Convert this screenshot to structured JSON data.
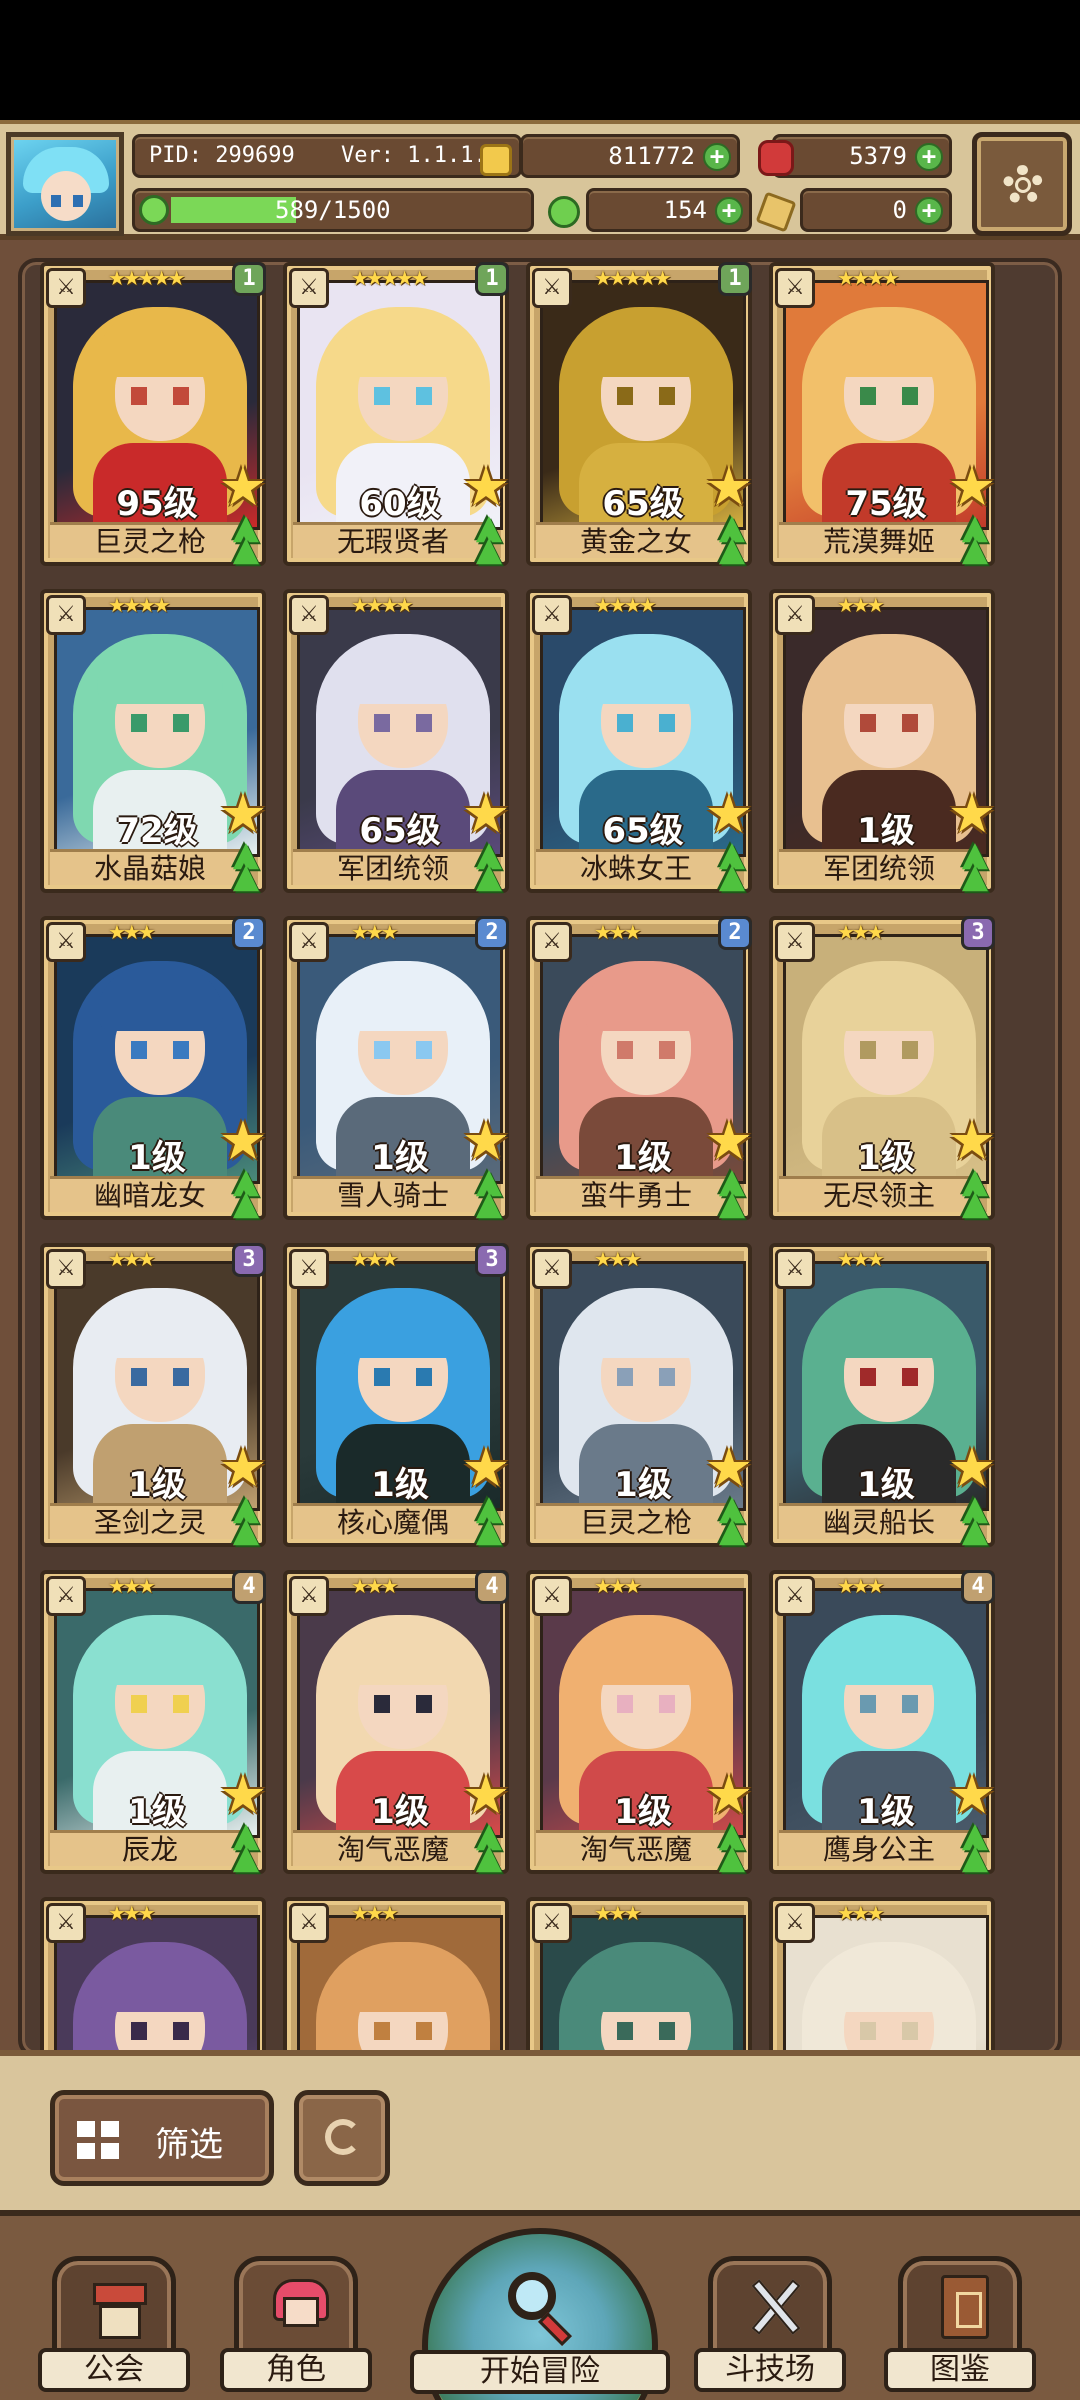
{
  "header": {
    "pid": "PID: 299699",
    "version": "Ver: 1.1.1.0",
    "gold": "811772",
    "gems": "5379",
    "exp": "589/1500",
    "exp_fraction": 0.39,
    "stamina": "154",
    "keys": "0",
    "plus": "+"
  },
  "cards": [
    {
      "name": "巨灵之枪",
      "level": "95级",
      "stars": "★★★★★",
      "tier": "1",
      "tier_color": "#6fa55a",
      "palette": [
        "#2a2a3a",
        "#e8b84a",
        "#c24a3a",
        "#c92a2a"
      ]
    },
    {
      "name": "无瑕贤者",
      "level": "60级",
      "stars": "★★★★★",
      "tier": "1",
      "tier_color": "#6fa55a",
      "palette": [
        "#e9e4f2",
        "#f6d98a",
        "#5ec1e0",
        "#f1f1f8"
      ]
    },
    {
      "name": "黄金之女",
      "level": "65级",
      "stars": "★★★★★",
      "tier": "1",
      "tier_color": "#6fa55a",
      "palette": [
        "#3a2a18",
        "#c8a030",
        "#8a6a18",
        "#d6b040"
      ]
    },
    {
      "name": "荒漠舞姬",
      "level": "75级",
      "stars": "★★★★",
      "tier": "",
      "tier_color": "",
      "palette": [
        "#e07a3a",
        "#f2c06a",
        "#3a8a4a",
        "#c23a2a"
      ]
    },
    {
      "name": "水晶菇娘",
      "level": "72级",
      "stars": "★★★★",
      "tier": "",
      "tier_color": "",
      "palette": [
        "#3a6a9a",
        "#7fd8b0",
        "#3a9a6a",
        "#e8f0f0"
      ]
    },
    {
      "name": "军团统领",
      "level": "65级",
      "stars": "★★★★",
      "tier": "",
      "tier_color": "",
      "palette": [
        "#3a3a4a",
        "#e0e0ee",
        "#7a6aa0",
        "#5a4a7a"
      ]
    },
    {
      "name": "冰蛛女王",
      "level": "65级",
      "stars": "★★★★",
      "tier": "",
      "tier_color": "",
      "palette": [
        "#2a4a6a",
        "#9ae0f0",
        "#4ab0d0",
        "#2a6a8a"
      ]
    },
    {
      "name": "军团统领",
      "level": "1级",
      "stars": "★★★",
      "tier": "",
      "tier_color": "",
      "palette": [
        "#3a2a2a",
        "#e8c090",
        "#b04a3a",
        "#4a2a20"
      ]
    },
    {
      "name": "幽暗龙女",
      "level": "1级",
      "stars": "★★★",
      "tier": "2",
      "tier_color": "#5a8ad0",
      "palette": [
        "#1a3a5a",
        "#2a5a9a",
        "#3a7ac0",
        "#4a8a7a"
      ]
    },
    {
      "name": "雪人骑士",
      "level": "1级",
      "stars": "★★★",
      "tier": "2",
      "tier_color": "#5a8ad0",
      "palette": [
        "#3a5a7a",
        "#e8f0f8",
        "#8ac8f0",
        "#5a6a7a"
      ]
    },
    {
      "name": "蛮牛勇士",
      "level": "1级",
      "stars": "★★★",
      "tier": "2",
      "tier_color": "#5a8ad0",
      "palette": [
        "#3a4a5a",
        "#e89a8a",
        "#d07a6a",
        "#7a4a3a"
      ]
    },
    {
      "name": "无尽领主",
      "level": "1级",
      "stars": "★★★",
      "tier": "3",
      "tier_color": "#8a6ab0",
      "palette": [
        "#c8b07a",
        "#e8d29a",
        "#b09a60",
        "#d8c088"
      ]
    },
    {
      "name": "圣剑之灵",
      "level": "1级",
      "stars": "★★★",
      "tier": "3",
      "tier_color": "#8a6ab0",
      "palette": [
        "#4a3a2a",
        "#e8ecf2",
        "#3a6aa0",
        "#c0a070"
      ]
    },
    {
      "name": "核心魔偶",
      "level": "1级",
      "stars": "★★★",
      "tier": "3",
      "tier_color": "#8a6ab0",
      "palette": [
        "#2a3a3a",
        "#3aa0e0",
        "#2a7ab0",
        "#1a2a2a"
      ]
    },
    {
      "name": "巨灵之枪",
      "level": "1级",
      "stars": "★★★",
      "tier": "",
      "tier_color": "",
      "palette": [
        "#3a4a5a",
        "#dfe6ee",
        "#8aa0b8",
        "#6a7a8a"
      ]
    },
    {
      "name": "幽灵船长",
      "level": "1级",
      "stars": "★★★",
      "tier": "",
      "tier_color": "",
      "palette": [
        "#3a5a6a",
        "#5ab090",
        "#a02a2a",
        "#2a2a2a"
      ]
    },
    {
      "name": "辰龙",
      "level": "1级",
      "stars": "★★★",
      "tier": "4",
      "tier_color": "#c0a070",
      "palette": [
        "#3a6a6a",
        "#8ae0d0",
        "#f0d050",
        "#e8f0f0"
      ]
    },
    {
      "name": "淘气恶魔",
      "level": "1级",
      "stars": "★★★",
      "tier": "4",
      "tier_color": "#c0a070",
      "palette": [
        "#4a3a4a",
        "#f2d8b0",
        "#2a2a3a",
        "#d84a4a"
      ]
    },
    {
      "name": "淘气恶魔",
      "level": "1级",
      "stars": "★★★",
      "tier": "",
      "tier_color": "",
      "palette": [
        "#5a3a4a",
        "#f0b070",
        "#e8b0c0",
        "#d04a4a"
      ]
    },
    {
      "name": "鹰身公主",
      "level": "1级",
      "stars": "★★★",
      "tier": "4",
      "tier_color": "#c0a070",
      "palette": [
        "#3a4a5a",
        "#7ae0e0",
        "#6a9ab0",
        "#4a5a6a"
      ]
    },
    {
      "name": "",
      "level": "",
      "stars": "★★★",
      "tier": "",
      "tier_color": "",
      "palette": [
        "#4a3a5a",
        "#7a5aa0",
        "#3a2a4a",
        "#6a5a8a"
      ]
    },
    {
      "name": "",
      "level": "",
      "stars": "★★★",
      "tier": "",
      "tier_color": "",
      "palette": [
        "#a06a3a",
        "#e0a060",
        "#c08040",
        "#8a5a30"
      ]
    },
    {
      "name": "",
      "level": "",
      "stars": "★★★",
      "tier": "",
      "tier_color": "",
      "palette": [
        "#2a4a4a",
        "#4a8a7a",
        "#3a6a5a",
        "#2a3a3a"
      ]
    },
    {
      "name": "",
      "level": "",
      "stars": "★★★",
      "tier": "",
      "tier_color": "",
      "palette": [
        "#e8e0d0",
        "#f0e8d8",
        "#d8c8a8",
        "#c8b898"
      ]
    }
  ],
  "filter": {
    "label": "筛选"
  },
  "nav": {
    "guild": "公会",
    "characters": "角色",
    "adventure": "开始冒险",
    "arena": "斗技场",
    "codex": "图鉴"
  }
}
